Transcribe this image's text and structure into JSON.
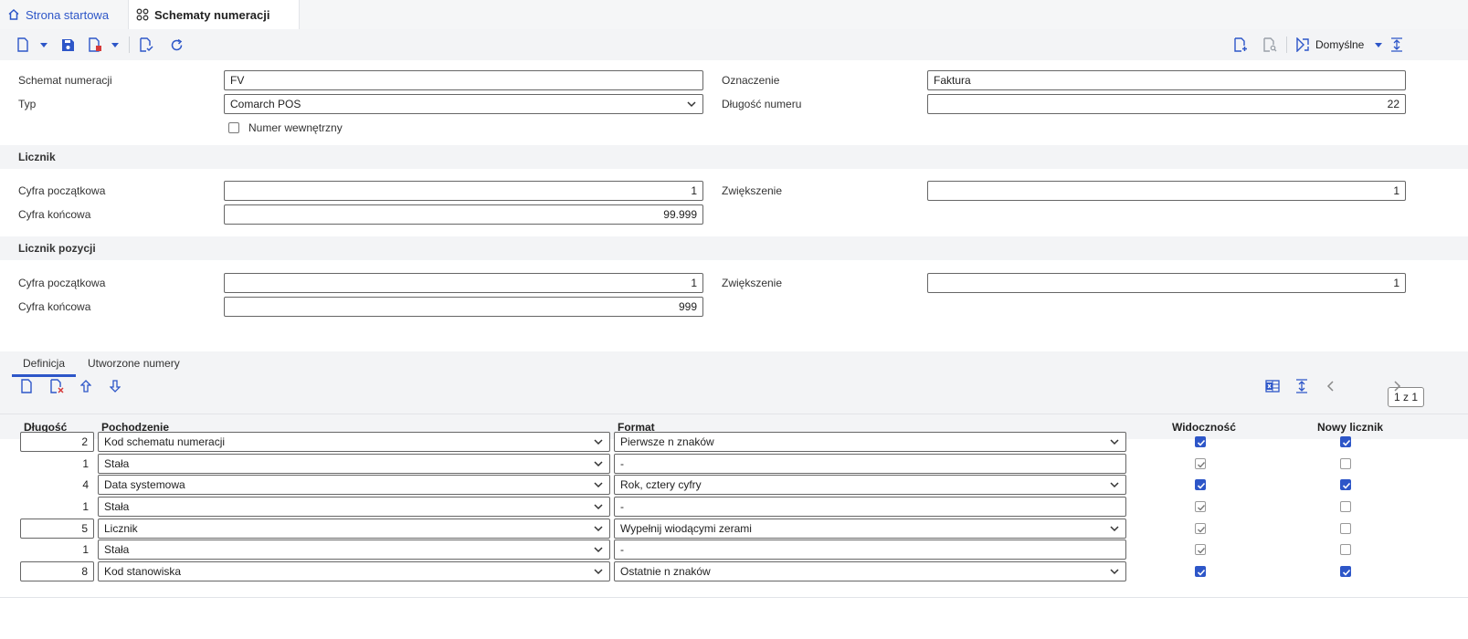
{
  "tabs": {
    "home": "Strona startowa",
    "active": "Schematy numeracji"
  },
  "toolbar": {
    "view_label": "Domyślne"
  },
  "form": {
    "schemat_label": "Schemat numeracji",
    "schemat_value": "FV",
    "oznaczenie_label": "Oznaczenie",
    "oznaczenie_value": "Faktura",
    "typ_label": "Typ",
    "typ_value": "Comarch POS",
    "dlugosc_label": "Długość numeru",
    "dlugosc_value": "22",
    "wewnetrzny_label": "Numer wewnętrzny",
    "wewnetrzny_checked": false
  },
  "licznik": {
    "title": "Licznik",
    "start_label": "Cyfra początkowa",
    "start_value": "1",
    "inc_label": "Zwiększenie",
    "inc_value": "1",
    "end_label": "Cyfra końcowa",
    "end_value": "99.999"
  },
  "licznik_pozycji": {
    "title": "Licznik pozycji",
    "start_label": "Cyfra początkowa",
    "start_value": "1",
    "inc_label": "Zwiększenie",
    "inc_value": "1",
    "end_label": "Cyfra końcowa",
    "end_value": "999"
  },
  "subtabs": {
    "definicja": "Definicja",
    "utworzone": "Utworzone numery"
  },
  "grid": {
    "pager": "1 z 1",
    "headers": {
      "dlugosc": "Długość",
      "pochodzenie": "Pochodzenie",
      "format": "Format",
      "widocznosc": "Widoczność",
      "nowy": "Nowy licznik"
    },
    "rows": [
      {
        "dlugosc": "2",
        "pochodzenie": "Kod schematu numeracji",
        "format": "Pierwsze n znaków"
      },
      {
        "dlugosc": "1",
        "pochodzenie": "Stała",
        "format": "-"
      },
      {
        "dlugosc": "4",
        "pochodzenie": "Data systemowa",
        "format": "Rok, cztery cyfry"
      },
      {
        "dlugosc": "1",
        "pochodzenie": "Stała",
        "format": "-"
      },
      {
        "dlugosc": "5",
        "pochodzenie": "Licznik",
        "format": "Wypełnij wiodącymi zerami"
      },
      {
        "dlugosc": "1",
        "pochodzenie": "Stała",
        "format": "-"
      },
      {
        "dlugosc": "8",
        "pochodzenie": "Kod stanowiska",
        "format": "Ostatnie n znaków"
      }
    ]
  },
  "colors": {
    "accent": "#2d56c8",
    "danger": "#d63a3a"
  }
}
